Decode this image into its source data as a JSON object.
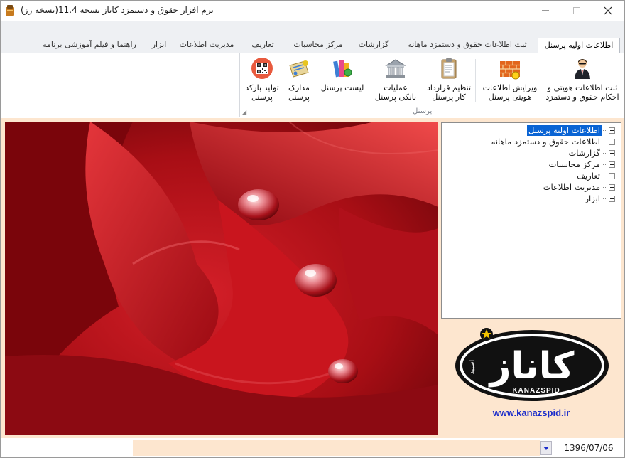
{
  "window": {
    "title": "نرم افزار حقوق و دستمزد کاناز نسخه 11.4(نسخه رز)",
    "icons": {
      "minimize": "minimize-icon",
      "maximize": "maximize-icon",
      "close": "close-icon",
      "app": "app-icon"
    }
  },
  "tabs": [
    {
      "label": "اطلاعات اولیه پرسنل",
      "active": true
    },
    {
      "label": "ثبت اطلاعات حقوق و دستمزد ماهانه",
      "active": false
    },
    {
      "label": "گزارشات",
      "active": false
    },
    {
      "label": "مرکز محاسبات",
      "active": false
    },
    {
      "label": "تعاریف",
      "active": false
    },
    {
      "label": "مدیریت اطلاعات",
      "active": false
    },
    {
      "label": "ابزار",
      "active": false
    },
    {
      "label": "راهنما و فیلم آموزشی برنامه",
      "active": false
    }
  ],
  "ribbon": {
    "group_label": "پرسنل",
    "buttons": [
      {
        "label": "ثبت اطلاعات هویتی و\nاحکام حقوق و دستمزد",
        "icon": "person-icon"
      },
      {
        "label": "ویرایش اطلاعات\nهویتی پرسنل",
        "icon": "brick-wall-icon"
      },
      {
        "label": "تنظیم قرارداد\nکار پرسنل",
        "icon": "clipboard-icon"
      },
      {
        "label": "عملیات\nبانکی پرسنل",
        "icon": "bank-icon"
      },
      {
        "label": "لیست پرسنل",
        "icon": "books-icon"
      },
      {
        "label": "مدارک\nپرسنل",
        "icon": "certificate-icon"
      },
      {
        "label": "تولید بارکد\nپرسنل",
        "icon": "qr-code-icon"
      }
    ]
  },
  "tree": {
    "items": [
      {
        "label": "اطلاعات اولیه پرسنل",
        "selected": true
      },
      {
        "label": "اطلاعات حقوق و دستمزد ماهانه",
        "selected": false
      },
      {
        "label": "گزارشات",
        "selected": false
      },
      {
        "label": "مرکز محاسبات",
        "selected": false
      },
      {
        "label": "تعاریف",
        "selected": false
      },
      {
        "label": "مدیریت اطلاعات",
        "selected": false
      },
      {
        "label": "ابزار",
        "selected": false
      }
    ]
  },
  "brand": {
    "logo_text": "کاناز",
    "logo_small": "اسپید",
    "logo_latin": "KANAZSPID",
    "website": "www.kanazspid.ir"
  },
  "status": {
    "date": "1396/07/06",
    "dropdown_icon": "dropdown-arrow-icon"
  },
  "colors": {
    "accent": "#0a64d4",
    "panel_bg": "#fde6cf",
    "link": "#1a2ccb",
    "rose": "#c4121b"
  }
}
